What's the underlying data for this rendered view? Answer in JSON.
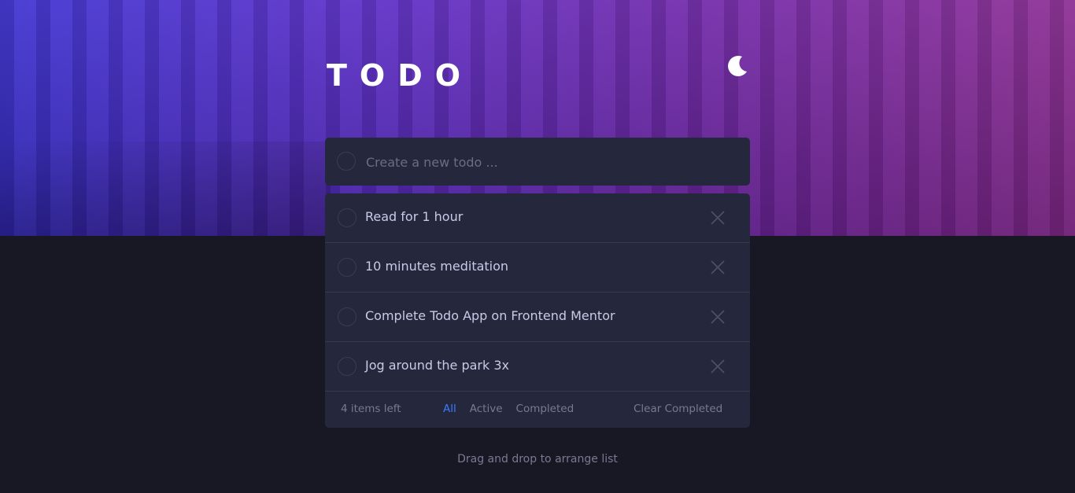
{
  "app": {
    "title": "TODO"
  },
  "new_todo": {
    "placeholder": "Create a new todo ..."
  },
  "todos": [
    {
      "text": "Read for 1 hour",
      "completed": false
    },
    {
      "text": "10 minutes meditation",
      "completed": false
    },
    {
      "text": "Complete Todo App on Frontend Mentor",
      "completed": false
    },
    {
      "text": "Jog around the park 3x",
      "completed": false
    }
  ],
  "footer": {
    "items_left": "4 items left",
    "filters": [
      "All",
      "Active",
      "Completed"
    ],
    "active_filter": "All",
    "clear_label": "Clear Completed"
  },
  "hint": "Drag and drop to arrange list",
  "icons": {
    "theme_toggle": "moon-icon",
    "delete": "close-icon"
  },
  "colors": {
    "accent": "#3a7bfd",
    "card": "#25273c",
    "background": "#181824"
  }
}
